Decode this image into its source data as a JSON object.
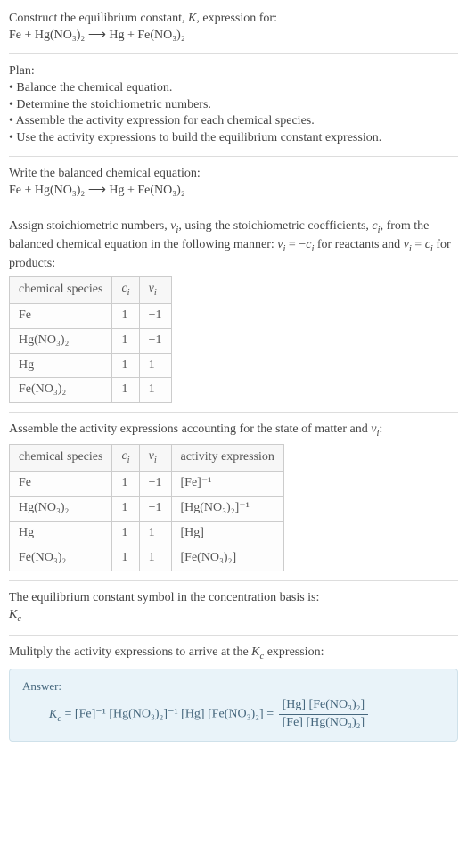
{
  "intro": {
    "title": "Construct the equilibrium constant, K, expression for:",
    "equation": "Fe + Hg(NO₃)₂  ⟶  Hg + Fe(NO₃)₂"
  },
  "plan": {
    "heading": "Plan:",
    "b1": "• Balance the chemical equation.",
    "b2": "• Determine the stoichiometric numbers.",
    "b3": "• Assemble the activity expression for each chemical species.",
    "b4": "• Use the activity expressions to build the equilibrium constant expression."
  },
  "balanced": {
    "heading": "Write the balanced chemical equation:",
    "equation": "Fe + Hg(NO₃)₂  ⟶  Hg + Fe(NO₃)₂"
  },
  "assign": {
    "text": "Assign stoichiometric numbers, νᵢ, using the stoichiometric coefficients, cᵢ, from the balanced chemical equation in the following manner: νᵢ = −cᵢ for reactants and νᵢ = cᵢ for products:",
    "headers": {
      "h1": "chemical species",
      "h2": "cᵢ",
      "h3": "νᵢ"
    },
    "rows": [
      {
        "sp": "Fe",
        "c": "1",
        "v": "−1"
      },
      {
        "sp": "Hg(NO₃)₂",
        "c": "1",
        "v": "−1"
      },
      {
        "sp": "Hg",
        "c": "1",
        "v": "1"
      },
      {
        "sp": "Fe(NO₃)₂",
        "c": "1",
        "v": "1"
      }
    ]
  },
  "activity": {
    "text": "Assemble the activity expressions accounting for the state of matter and νᵢ:",
    "headers": {
      "h1": "chemical species",
      "h2": "cᵢ",
      "h3": "νᵢ",
      "h4": "activity expression"
    },
    "rows": [
      {
        "sp": "Fe",
        "c": "1",
        "v": "−1",
        "a": "[Fe]⁻¹"
      },
      {
        "sp": "Hg(NO₃)₂",
        "c": "1",
        "v": "−1",
        "a": "[Hg(NO₃)₂]⁻¹"
      },
      {
        "sp": "Hg",
        "c": "1",
        "v": "1",
        "a": "[Hg]"
      },
      {
        "sp": "Fe(NO₃)₂",
        "c": "1",
        "v": "1",
        "a": "[Fe(NO₃)₂]"
      }
    ]
  },
  "symbol": {
    "line1": "The equilibrium constant symbol in the concentration basis is:",
    "line2": "K_c"
  },
  "multiply": {
    "text": "Mulitply the activity expressions to arrive at the K_c expression:"
  },
  "answer": {
    "label": "Answer:",
    "lhs": "K_c = [Fe]⁻¹ [Hg(NO₃)₂]⁻¹ [Hg] [Fe(NO₃)₂] = ",
    "num": "[Hg] [Fe(NO₃)₂]",
    "den": "[Fe] [Hg(NO₃)₂]"
  }
}
